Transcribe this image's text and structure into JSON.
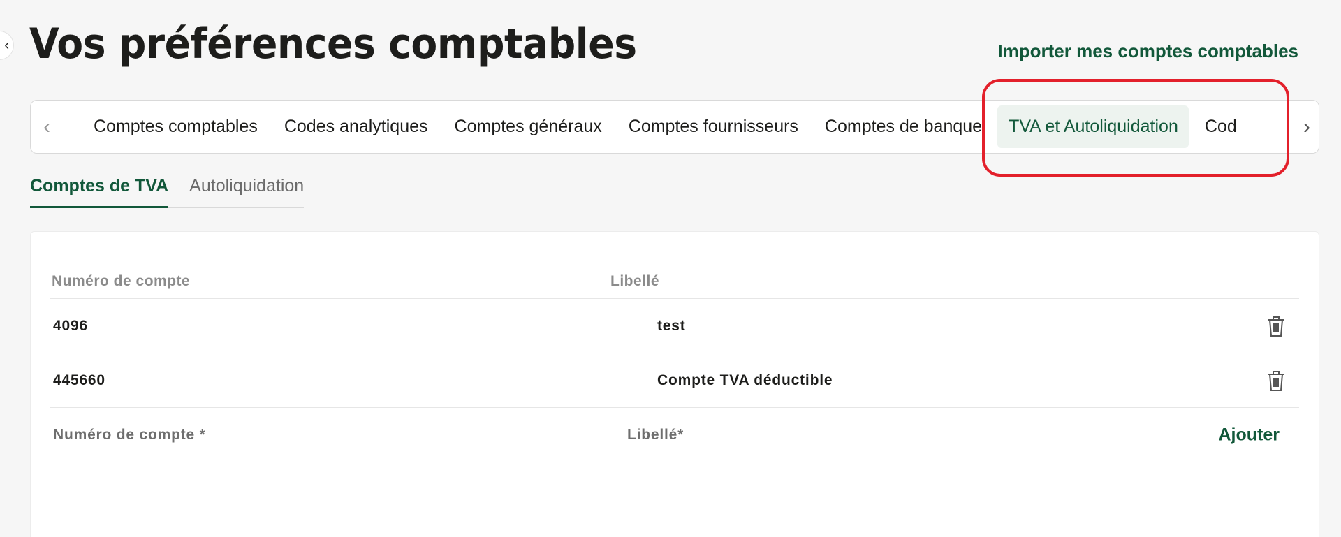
{
  "header": {
    "title": "Vos préférences comptables",
    "import_link": "Importer mes comptes comptables",
    "back_icon": "arrow-left-icon"
  },
  "tabs": {
    "items": [
      {
        "label": "Comptes comptables",
        "active": false
      },
      {
        "label": "Codes analytiques",
        "active": false
      },
      {
        "label": "Comptes généraux",
        "active": false
      },
      {
        "label": "Comptes fournisseurs",
        "active": false
      },
      {
        "label": "Comptes de banque",
        "active": false
      },
      {
        "label": "TVA et Autoliquidation",
        "active": true
      },
      {
        "label": "Cod",
        "active": false
      }
    ],
    "prev_icon": "chevron-left-icon",
    "next_icon": "chevron-right-icon"
  },
  "subtabs": [
    {
      "label": "Comptes de TVA",
      "active": true
    },
    {
      "label": "Autoliquidation",
      "active": false
    }
  ],
  "table": {
    "headers": {
      "account_number": "Numéro de compte",
      "label": "Libellé"
    },
    "rows": [
      {
        "account_number": "4096",
        "label": "test"
      },
      {
        "account_number": "445660",
        "label": "Compte TVA déductible"
      }
    ],
    "form": {
      "account_placeholder": "Numéro de compte *",
      "label_placeholder": "Libellé*",
      "add_label": "Ajouter"
    },
    "delete_icon": "trash-icon"
  },
  "colors": {
    "brand_green": "#12583a",
    "active_tab_bg": "#edf3ef",
    "annotation_red": "#e3202b",
    "page_bg": "#f6f6f6"
  }
}
